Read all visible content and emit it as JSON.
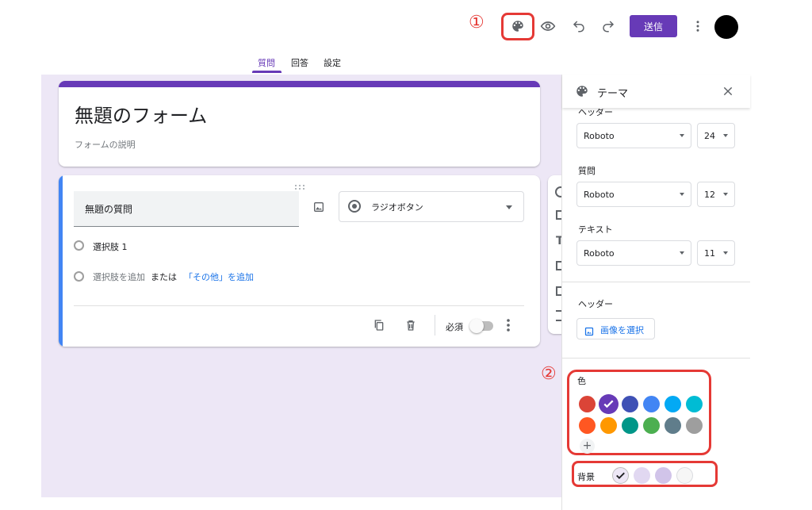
{
  "toolbar": {
    "send_label": "送信",
    "icons": [
      "palette-icon",
      "eye-icon",
      "undo-icon",
      "redo-icon",
      "more-vert-icon"
    ]
  },
  "annotations": {
    "one": "①",
    "two": "②"
  },
  "tabs": [
    {
      "label": "質問",
      "active": true
    },
    {
      "label": "回答",
      "active": false
    },
    {
      "label": "設定",
      "active": false
    }
  ],
  "form": {
    "title": "無題のフォーム",
    "description": "フォームの説明",
    "accent_color": "#673ab7",
    "canvas_color": "#ede7f6"
  },
  "question": {
    "title": "無題の質問",
    "type_label": "ラジオボタン",
    "option_1": "選択肢 1",
    "add_option": "選択肢を追加",
    "or_text": "または",
    "add_other": "「その他」を追加",
    "required_label": "必須",
    "required": false
  },
  "theme_panel": {
    "title": "テーマ",
    "header_section_label": "ヘッダー",
    "header_font": "Roboto",
    "header_size": "24",
    "question_label": "質問",
    "question_font": "Roboto",
    "question_size": "12",
    "text_label": "テキスト",
    "text_font": "Roboto",
    "text_size": "11",
    "header_image_label": "ヘッダー",
    "select_image_label": "画像を選択",
    "color_label": "色",
    "background_label": "背景",
    "colors": [
      "#db4437",
      "#673ab7",
      "#3f51b5",
      "#4285f4",
      "#03a9f4",
      "#00bcd4",
      "#ff5722",
      "#ff9800",
      "#009688",
      "#4caf50",
      "#607d8b",
      "#9e9e9e"
    ],
    "selected_color": "#673ab7",
    "backgrounds": [
      "#ede7f6",
      "#e1d8f1",
      "#d1c4e9",
      "#f6f6f6"
    ],
    "selected_background": "#ede7f6"
  }
}
